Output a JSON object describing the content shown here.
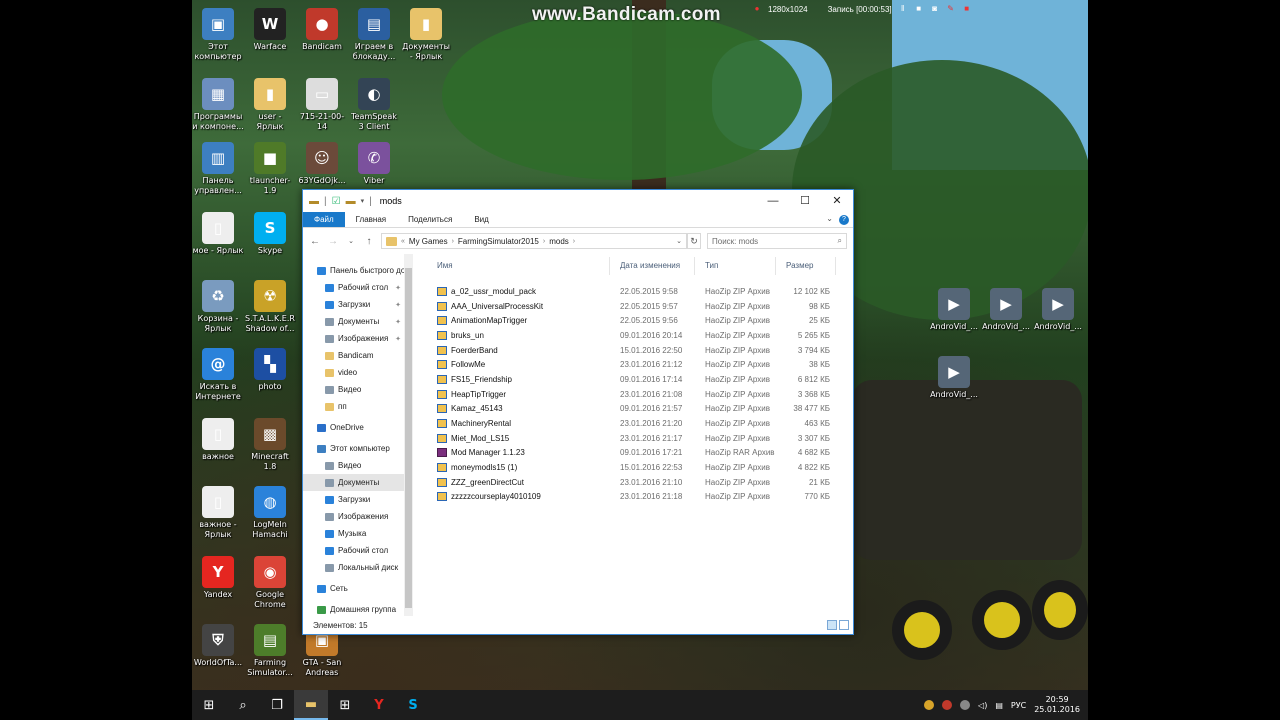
{
  "watermark": "www.Bandicam.com",
  "recorder": {
    "resolution": "1280x1024",
    "status": "Запись [00:00:53]"
  },
  "desktop_icons": [
    {
      "label": "Этот компьютер",
      "color": "#3d7fc1",
      "glyph": "▣"
    },
    {
      "label": "Warface",
      "color": "#222222",
      "glyph": "W"
    },
    {
      "label": "Bandicam",
      "color": "#c0392b",
      "glyph": "●"
    },
    {
      "label": "Играем в блокаду...",
      "color": "#2b5fa0",
      "glyph": "▤"
    },
    {
      "label": "Документы - Ярлык",
      "color": "#e8c36a",
      "glyph": "▮"
    },
    {
      "label": "Программы и компоне...",
      "color": "#6c8ebf",
      "glyph": "▦"
    },
    {
      "label": "user - Ярлык",
      "color": "#e8c36a",
      "glyph": "▮"
    },
    {
      "label": "715-21-00-14",
      "color": "#dddddd",
      "glyph": "▭"
    },
    {
      "label": "TeamSpeak 3 Client",
      "color": "#334455",
      "glyph": "◐"
    },
    {
      "label": "Панель управлен...",
      "color": "#3d7fc1",
      "glyph": "▥"
    },
    {
      "label": "tlauncher-1.9",
      "color": "#4f7a28",
      "glyph": "■"
    },
    {
      "label": "63YGdOjk...",
      "color": "#6b4a3a",
      "glyph": "☺"
    },
    {
      "label": "Viber",
      "color": "#7b519d",
      "glyph": "✆"
    },
    {
      "label": "мое - Ярлык",
      "color": "#eeeeee",
      "glyph": "▯"
    },
    {
      "label": "Skype",
      "color": "#00aff0",
      "glyph": "S"
    },
    {
      "label": "Корзина - Ярлык",
      "color": "#7a9bbf",
      "glyph": "♻"
    },
    {
      "label": "S.T.A.L.K.E.R Shadow of...",
      "color": "#c9a227",
      "glyph": "☢"
    },
    {
      "label": "Искать в Интернете",
      "color": "#2a82da",
      "glyph": "@"
    },
    {
      "label": "photo",
      "color": "#1d4fa3",
      "glyph": "▚"
    },
    {
      "label": "важное",
      "color": "#eeeeee",
      "glyph": "▯"
    },
    {
      "label": "Minecraft 1.8",
      "color": "#6b4a2b",
      "glyph": "▩"
    },
    {
      "label": "важное - Ярлык",
      "color": "#eeeeee",
      "glyph": "▯"
    },
    {
      "label": "LogMeIn Hamachi",
      "color": "#2a82da",
      "glyph": "◍"
    },
    {
      "label": "Yandex",
      "color": "#e52620",
      "glyph": "Y"
    },
    {
      "label": "Google Chrome",
      "color": "#db4437",
      "glyph": "◉"
    },
    {
      "label": "WorldOfTa...",
      "color": "#444444",
      "glyph": "⛨"
    },
    {
      "label": "Farming Simulator...",
      "color": "#4d7d2a",
      "glyph": "▤"
    },
    {
      "label": "GTA - San Andreas",
      "color": "#c27a2a",
      "glyph": "▣"
    },
    {
      "label": "AndroVid_...",
      "color": "#556677",
      "glyph": "▶"
    },
    {
      "label": "AndroVid_...",
      "color": "#556677",
      "glyph": "▶"
    },
    {
      "label": "AndroVid_...",
      "color": "#556677",
      "glyph": "▶"
    },
    {
      "label": "AndroVid_...",
      "color": "#556677",
      "glyph": "▶"
    }
  ],
  "explorer": {
    "title": "mods",
    "tabs": [
      "Файл",
      "Главная",
      "Поделиться",
      "Вид"
    ],
    "breadcrumb": [
      "My Games",
      "FarmingSimulator2015",
      "mods"
    ],
    "search_placeholder": "Поиск: mods",
    "columns": {
      "name": "Имя",
      "date": "Дата изменения",
      "type": "Тип",
      "size": "Размер"
    },
    "nav": [
      {
        "label": "Панель быстрого доступа",
        "color": "#2a82da",
        "pin": false,
        "sel": false,
        "indent": 0
      },
      {
        "label": "Рабочий стол",
        "color": "#2a82da",
        "pin": true,
        "sel": false,
        "indent": 1
      },
      {
        "label": "Загрузки",
        "color": "#2a82da",
        "pin": true,
        "sel": false,
        "indent": 1
      },
      {
        "label": "Документы",
        "color": "#8899aa",
        "pin": true,
        "sel": false,
        "indent": 1
      },
      {
        "label": "Изображения",
        "color": "#8899aa",
        "pin": true,
        "sel": false,
        "indent": 1
      },
      {
        "label": "Bandicam",
        "color": "#e8c36a",
        "pin": false,
        "sel": false,
        "indent": 1
      },
      {
        "label": "video",
        "color": "#e8c36a",
        "pin": false,
        "sel": false,
        "indent": 1
      },
      {
        "label": "Видео",
        "color": "#8899aa",
        "pin": false,
        "sel": false,
        "indent": 1
      },
      {
        "label": "пп",
        "color": "#e8c36a",
        "pin": false,
        "sel": false,
        "indent": 1
      },
      {
        "label": "OneDrive",
        "color": "#2a6fc9",
        "pin": false,
        "sel": false,
        "indent": 0
      },
      {
        "label": "Этот компьютер",
        "color": "#3d7fc1",
        "pin": false,
        "sel": false,
        "indent": 0
      },
      {
        "label": "Видео",
        "color": "#8899aa",
        "pin": false,
        "sel": false,
        "indent": 1
      },
      {
        "label": "Документы",
        "color": "#8899aa",
        "pin": false,
        "sel": true,
        "indent": 1
      },
      {
        "label": "Загрузки",
        "color": "#2a82da",
        "pin": false,
        "sel": false,
        "indent": 1
      },
      {
        "label": "Изображения",
        "color": "#8899aa",
        "pin": false,
        "sel": false,
        "indent": 1
      },
      {
        "label": "Музыка",
        "color": "#2a82da",
        "pin": false,
        "sel": false,
        "indent": 1
      },
      {
        "label": "Рабочий стол",
        "color": "#2a82da",
        "pin": false,
        "sel": false,
        "indent": 1
      },
      {
        "label": "Локальный диск",
        "color": "#8899aa",
        "pin": false,
        "sel": false,
        "indent": 1
      },
      {
        "label": "Сеть",
        "color": "#2a82da",
        "pin": false,
        "sel": false,
        "indent": 0
      },
      {
        "label": "Домашняя группа",
        "color": "#3a9a48",
        "pin": false,
        "sel": false,
        "indent": 0
      }
    ],
    "files": [
      {
        "name": "a_02_ussr_modul_pack",
        "date": "22.05.2015 9:58",
        "type": "HaoZip ZIP Архив",
        "size": "12 102 КБ",
        "kind": "zip"
      },
      {
        "name": "AAA_UniversalProcessKit",
        "date": "22.05.2015 9:57",
        "type": "HaoZip ZIP Архив",
        "size": "98 КБ",
        "kind": "zip"
      },
      {
        "name": "AnimationMapTrigger",
        "date": "22.05.2015 9:56",
        "type": "HaoZip ZIP Архив",
        "size": "25 КБ",
        "kind": "zip"
      },
      {
        "name": "bruks_un",
        "date": "09.01.2016 20:14",
        "type": "HaoZip ZIP Архив",
        "size": "5 265 КБ",
        "kind": "zip"
      },
      {
        "name": "FoerderBand",
        "date": "15.01.2016 22:50",
        "type": "HaoZip ZIP Архив",
        "size": "3 794 КБ",
        "kind": "zip"
      },
      {
        "name": "FollowMe",
        "date": "23.01.2016 21:12",
        "type": "HaoZip ZIP Архив",
        "size": "38 КБ",
        "kind": "zip"
      },
      {
        "name": "FS15_Friendship",
        "date": "09.01.2016 17:14",
        "type": "HaoZip ZIP Архив",
        "size": "6 812 КБ",
        "kind": "zip"
      },
      {
        "name": "HeapTipTrigger",
        "date": "23.01.2016 21:08",
        "type": "HaoZip ZIP Архив",
        "size": "3 368 КБ",
        "kind": "zip"
      },
      {
        "name": "Kamaz_45143",
        "date": "09.01.2016 21:57",
        "type": "HaoZip ZIP Архив",
        "size": "38 477 КБ",
        "kind": "zip"
      },
      {
        "name": "MachineryRental",
        "date": "23.01.2016 21:20",
        "type": "HaoZip ZIP Архив",
        "size": "463 КБ",
        "kind": "zip"
      },
      {
        "name": "Miet_Mod_LS15",
        "date": "23.01.2016 21:17",
        "type": "HaoZip ZIP Архив",
        "size": "3 307 КБ",
        "kind": "zip"
      },
      {
        "name": "Mod Manager 1.1.23",
        "date": "09.01.2016 17:21",
        "type": "HaoZip RAR Архив",
        "size": "4 682 КБ",
        "kind": "rar"
      },
      {
        "name": "moneymodls15 (1)",
        "date": "15.01.2016 22:53",
        "type": "HaoZip ZIP Архив",
        "size": "4 822 КБ",
        "kind": "zip"
      },
      {
        "name": "ZZZ_greenDirectCut",
        "date": "23.01.2016 21:10",
        "type": "HaoZip ZIP Архив",
        "size": "21 КБ",
        "kind": "zip"
      },
      {
        "name": "zzzzzcourseplay4010109",
        "date": "23.01.2016 21:18",
        "type": "HaoZip ZIP Архив",
        "size": "770 КБ",
        "kind": "zip"
      }
    ],
    "status": "Элементов: 15"
  },
  "taskbar": {
    "language": "РУС",
    "time": "20:59",
    "date": "25.01.2016"
  }
}
